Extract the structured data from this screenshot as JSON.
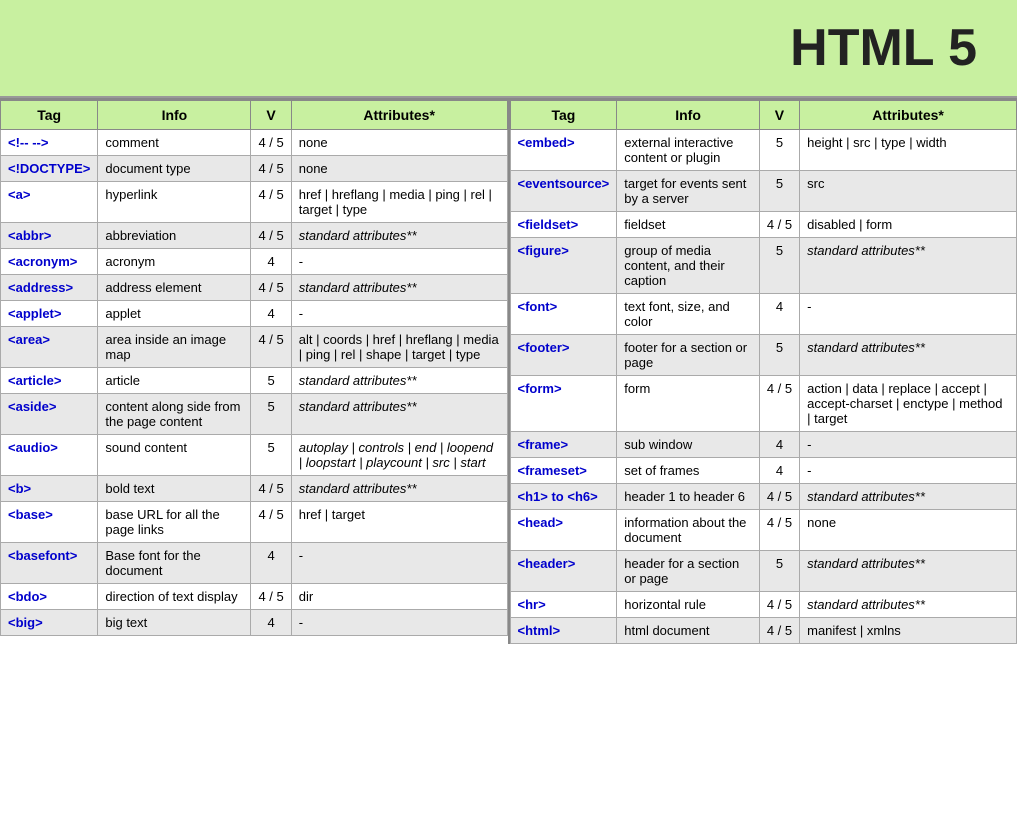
{
  "title": "HTML 5",
  "left_headers": [
    "Tag",
    "Info",
    "V",
    "Attributes*"
  ],
  "right_headers": [
    "Tag",
    "Info",
    "V",
    "Attributes*"
  ],
  "left_rows": [
    {
      "tag": "<!-- -->",
      "info": "comment",
      "v": "4 / 5",
      "attrs": "none",
      "shaded": false
    },
    {
      "tag": "<!DOCTYPE>",
      "info": "document type",
      "v": "4 / 5",
      "attrs": "none",
      "shaded": true
    },
    {
      "tag": "<a>",
      "info": "hyperlink",
      "v": "4 / 5",
      "attrs": "href | hreflang | media | ping | rel | target | type",
      "shaded": false
    },
    {
      "tag": "<abbr>",
      "info": "abbreviation",
      "v": "4 / 5",
      "attrs": "standard attributes**",
      "italic": true,
      "shaded": true
    },
    {
      "tag": "<acronym>",
      "info": "acronym",
      "v": "4",
      "attrs": "-",
      "shaded": false
    },
    {
      "tag": "<address>",
      "info": "address element",
      "v": "4 / 5",
      "attrs": "standard attributes**",
      "italic": true,
      "shaded": true
    },
    {
      "tag": "<applet>",
      "info": "applet",
      "v": "4",
      "attrs": "-",
      "shaded": false
    },
    {
      "tag": "<area>",
      "info": "area inside an image map",
      "v": "4 / 5",
      "attrs": "alt | coords | href | hreflang | media | ping | rel | shape | target | type",
      "shaded": true
    },
    {
      "tag": "<article>",
      "info": "article",
      "v": "5",
      "attrs": "standard attributes**",
      "italic": true,
      "shaded": false
    },
    {
      "tag": "<aside>",
      "info": "content along side from the page content",
      "v": "5",
      "attrs": "standard attributes**",
      "italic": true,
      "shaded": true
    },
    {
      "tag": "<audio>",
      "info": "sound content",
      "v": "5",
      "attrs": "autoplay | controls | end | loopend | loopstart | playcount | src | start",
      "italic": true,
      "shaded": false
    },
    {
      "tag": "<b>",
      "info": "bold text",
      "v": "4 / 5",
      "attrs": "standard attributes**",
      "italic": true,
      "shaded": true
    },
    {
      "tag": "<base>",
      "info": "base URL for all the page links",
      "v": "4 / 5",
      "attrs": "href | target",
      "shaded": false
    },
    {
      "tag": "<basefont>",
      "info": "Base font for the document",
      "v": "4",
      "attrs": "-",
      "shaded": true
    },
    {
      "tag": "<bdo>",
      "info": "direction of text display",
      "v": "4 / 5",
      "attrs": "dir",
      "shaded": false
    },
    {
      "tag": "<big>",
      "info": "big text",
      "v": "4",
      "attrs": "-",
      "shaded": true
    }
  ],
  "right_rows": [
    {
      "tag": "<embed>",
      "info": "external interactive content or plugin",
      "v": "5",
      "attrs": "height | src | type | width",
      "shaded": false
    },
    {
      "tag": "<eventsource>",
      "info": "target for events sent by a server",
      "v": "5",
      "attrs": "src",
      "shaded": true
    },
    {
      "tag": "<fieldset>",
      "info": "fieldset",
      "v": "4 / 5",
      "attrs": "disabled | form",
      "shaded": false
    },
    {
      "tag": "<figure>",
      "info": "group of media content, and their caption",
      "v": "5",
      "attrs": "standard attributes**",
      "italic": true,
      "shaded": true
    },
    {
      "tag": "<font>",
      "info": "text font, size, and color",
      "v": "4",
      "attrs": "-",
      "shaded": false
    },
    {
      "tag": "<footer>",
      "info": "footer for a section or page",
      "v": "5",
      "attrs": "standard attributes**",
      "italic": true,
      "shaded": true
    },
    {
      "tag": "<form>",
      "info": "form",
      "v": "4 / 5",
      "attrs": "action | data | replace | accept | accept-charset | enctype | method | target",
      "shaded": false
    },
    {
      "tag": "<frame>",
      "info": "sub window",
      "v": "4",
      "attrs": "-",
      "shaded": true
    },
    {
      "tag": "<frameset>",
      "info": "set of frames",
      "v": "4",
      "attrs": "-",
      "shaded": false
    },
    {
      "tag": "<h1> to <h6>",
      "info": "header 1 to header 6",
      "v": "4 / 5",
      "attrs": "standard attributes**",
      "italic": true,
      "shaded": true
    },
    {
      "tag": "<head>",
      "info": "information about the document",
      "v": "4 / 5",
      "attrs": "none",
      "shaded": false
    },
    {
      "tag": "<header>",
      "info": "header for a section or page",
      "v": "5",
      "attrs": "standard attributes**",
      "italic": true,
      "shaded": true
    },
    {
      "tag": "<hr>",
      "info": "horizontal rule",
      "v": "4 / 5",
      "attrs": "standard attributes**",
      "italic": true,
      "shaded": false
    },
    {
      "tag": "<html>",
      "info": "html document",
      "v": "4 / 5",
      "attrs": "manifest | xmlns",
      "shaded": true
    }
  ]
}
